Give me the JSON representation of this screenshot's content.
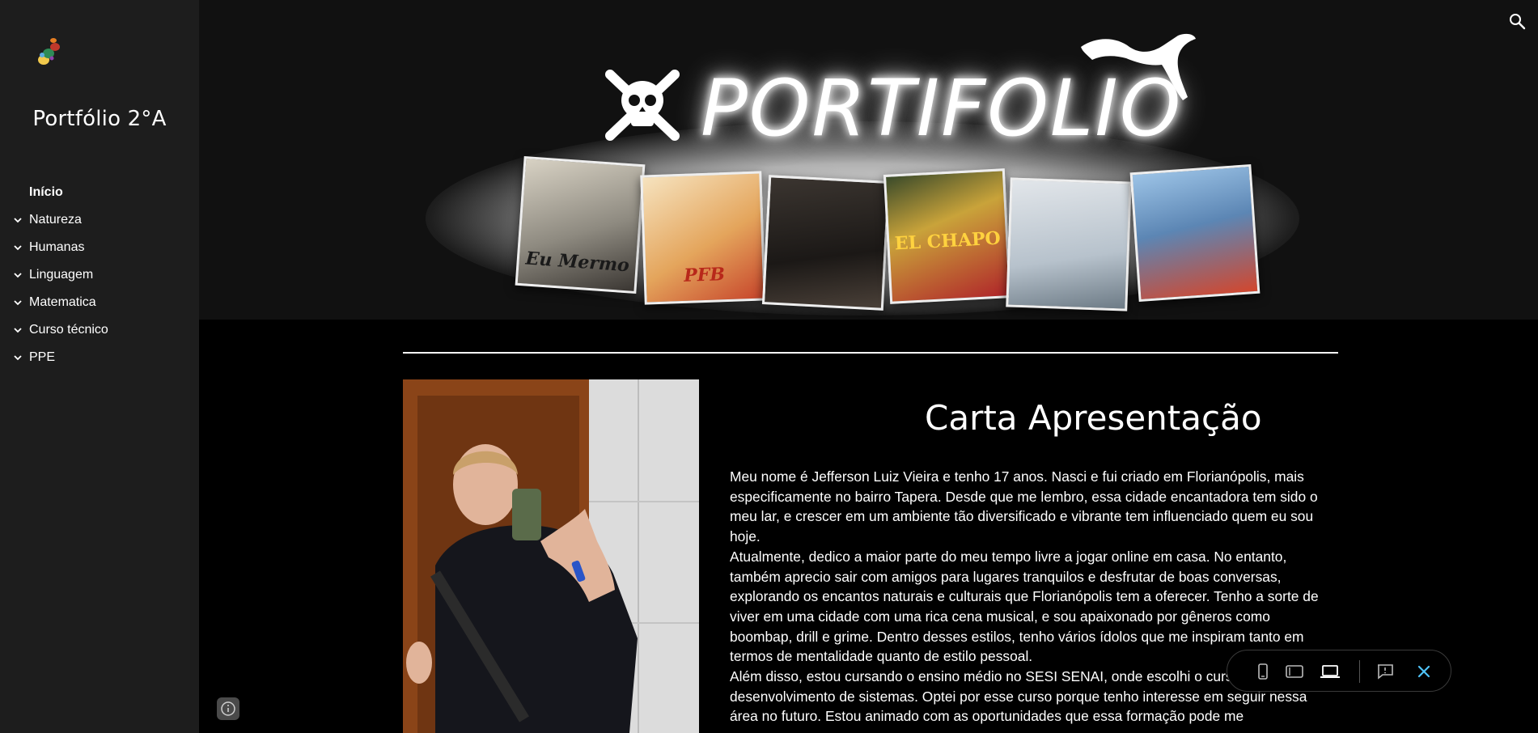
{
  "sidebar": {
    "site_title": "Portfólio 2°A",
    "items": [
      {
        "label": "Início",
        "active": true,
        "expandable": false
      },
      {
        "label": "Natureza",
        "active": false,
        "expandable": true
      },
      {
        "label": "Humanas",
        "active": false,
        "expandable": true
      },
      {
        "label": "Linguagem",
        "active": false,
        "expandable": true
      },
      {
        "label": "Matematica",
        "active": false,
        "expandable": true
      },
      {
        "label": "Curso técnico",
        "active": false,
        "expandable": true
      },
      {
        "label": "PPE",
        "active": false,
        "expandable": true
      }
    ]
  },
  "header": {
    "banner_title": "PORTIFOLIO",
    "albums": [
      {
        "label": "Eu Mermo",
        "color": "#c9c3b5"
      },
      {
        "label": "PFB",
        "color": "#e8c28a"
      },
      {
        "label": "",
        "color": "#2a2622"
      },
      {
        "label": "EL CHAPO",
        "color": "#c9a33a"
      },
      {
        "label": "",
        "color": "#c7cfd6"
      },
      {
        "label": "",
        "color": "#7da7cf"
      }
    ],
    "search_icon": "search-icon"
  },
  "main": {
    "title": "Carta Apresentação",
    "paragraphs": [
      "Meu nome é Jefferson Luiz Vieira e tenho 17 anos. Nasci e fui criado em Florianópolis, mais especificamente no bairro Tapera. Desde que me lembro, essa cidade encantadora tem sido o meu lar, e crescer em um ambiente tão diversificado e vibrante tem influenciado quem eu sou hoje.",
      "Atualmente, dedico a maior parte do meu tempo livre a jogar online em casa. No entanto, também aprecio sair com amigos para lugares tranquilos e desfrutar de boas conversas, explorando os encantos naturais e culturais que Florianópolis tem a oferecer. Tenho a sorte de viver em uma cidade com uma rica cena musical, e sou apaixonado por gêneros como boombap, drill e grime. Dentro desses estilos, tenho vários ídolos que me inspiram tanto em termos de mentalidade quanto de estilo pessoal.",
      "Além disso, estou cursando o ensino médio no SESI SENAI, onde escolhi o curso de desenvolvimento de sistemas. Optei por esse curso porque tenho interesse em seguir nessa área no futuro. Estou animado com as oportunidades que essa formação pode me"
    ]
  },
  "device_toolbar": {
    "icons": [
      "phone-icon",
      "tablet-icon",
      "laptop-icon",
      "feedback-icon",
      "close-icon"
    ]
  },
  "colors": {
    "sidebar_bg": "#1d1d1d",
    "header_bg": "#111111",
    "page_bg": "#000000",
    "accent": "#4fc3f7"
  }
}
